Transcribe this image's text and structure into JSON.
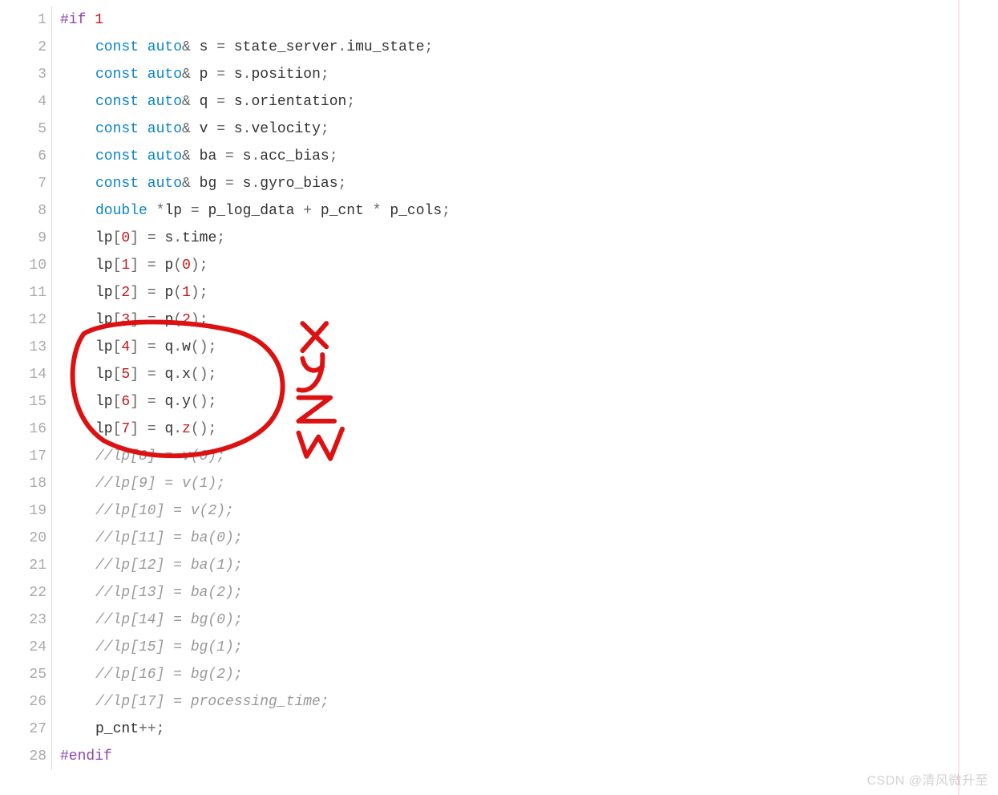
{
  "watermark": "CSDN @清风微升至",
  "code": {
    "indent": [
      0,
      1,
      1,
      1,
      1,
      1,
      1,
      1,
      1,
      1,
      1,
      1,
      1,
      1,
      1,
      1,
      1,
      1,
      1,
      1,
      1,
      1,
      1,
      1,
      1,
      1,
      1,
      0
    ],
    "lines": [
      [
        {
          "c": "tok-pre",
          "t": "#if "
        },
        {
          "c": "tok-num",
          "t": "1"
        }
      ],
      [
        {
          "c": "tok-kw",
          "t": "const auto"
        },
        {
          "c": "tok-amp",
          "t": "& "
        },
        {
          "c": "tok-id",
          "t": "s "
        },
        {
          "c": "tok-op",
          "t": "= "
        },
        {
          "c": "tok-id",
          "t": "state_server"
        },
        {
          "c": "tok-punc",
          "t": "."
        },
        {
          "c": "tok-id",
          "t": "imu_state"
        },
        {
          "c": "tok-punc",
          "t": ";"
        }
      ],
      [
        {
          "c": "tok-kw",
          "t": "const auto"
        },
        {
          "c": "tok-amp",
          "t": "& "
        },
        {
          "c": "tok-id",
          "t": "p "
        },
        {
          "c": "tok-op",
          "t": "= "
        },
        {
          "c": "tok-id",
          "t": "s"
        },
        {
          "c": "tok-punc",
          "t": "."
        },
        {
          "c": "tok-id",
          "t": "position"
        },
        {
          "c": "tok-punc",
          "t": ";"
        }
      ],
      [
        {
          "c": "tok-kw",
          "t": "const auto"
        },
        {
          "c": "tok-amp",
          "t": "& "
        },
        {
          "c": "tok-id",
          "t": "q "
        },
        {
          "c": "tok-op",
          "t": "= "
        },
        {
          "c": "tok-id",
          "t": "s"
        },
        {
          "c": "tok-punc",
          "t": "."
        },
        {
          "c": "tok-id",
          "t": "orientation"
        },
        {
          "c": "tok-punc",
          "t": ";"
        }
      ],
      [
        {
          "c": "tok-kw",
          "t": "const auto"
        },
        {
          "c": "tok-amp",
          "t": "& "
        },
        {
          "c": "tok-id",
          "t": "v "
        },
        {
          "c": "tok-op",
          "t": "= "
        },
        {
          "c": "tok-id",
          "t": "s"
        },
        {
          "c": "tok-punc",
          "t": "."
        },
        {
          "c": "tok-id",
          "t": "velocity"
        },
        {
          "c": "tok-punc",
          "t": ";"
        }
      ],
      [
        {
          "c": "tok-kw",
          "t": "const auto"
        },
        {
          "c": "tok-amp",
          "t": "& "
        },
        {
          "c": "tok-id",
          "t": "ba "
        },
        {
          "c": "tok-op",
          "t": "= "
        },
        {
          "c": "tok-id",
          "t": "s"
        },
        {
          "c": "tok-punc",
          "t": "."
        },
        {
          "c": "tok-id",
          "t": "acc_bias"
        },
        {
          "c": "tok-punc",
          "t": ";"
        }
      ],
      [
        {
          "c": "tok-kw",
          "t": "const auto"
        },
        {
          "c": "tok-amp",
          "t": "& "
        },
        {
          "c": "tok-id",
          "t": "bg "
        },
        {
          "c": "tok-op",
          "t": "= "
        },
        {
          "c": "tok-id",
          "t": "s"
        },
        {
          "c": "tok-punc",
          "t": "."
        },
        {
          "c": "tok-id",
          "t": "gyro_bias"
        },
        {
          "c": "tok-punc",
          "t": ";"
        }
      ],
      [
        {
          "c": "tok-kw",
          "t": "double "
        },
        {
          "c": "tok-op",
          "t": "*"
        },
        {
          "c": "tok-id",
          "t": "lp "
        },
        {
          "c": "tok-op",
          "t": "= "
        },
        {
          "c": "tok-id",
          "t": "p_log_data "
        },
        {
          "c": "tok-op",
          "t": "+ "
        },
        {
          "c": "tok-id",
          "t": "p_cnt "
        },
        {
          "c": "tok-op",
          "t": "* "
        },
        {
          "c": "tok-id",
          "t": "p_cols"
        },
        {
          "c": "tok-punc",
          "t": ";"
        }
      ],
      [
        {
          "c": "tok-id",
          "t": "lp"
        },
        {
          "c": "tok-punc",
          "t": "["
        },
        {
          "c": "tok-num",
          "t": "0"
        },
        {
          "c": "tok-punc",
          "t": "] "
        },
        {
          "c": "tok-op",
          "t": "= "
        },
        {
          "c": "tok-id",
          "t": "s"
        },
        {
          "c": "tok-punc",
          "t": "."
        },
        {
          "c": "tok-mem",
          "t": "time"
        },
        {
          "c": "tok-punc",
          "t": ";"
        }
      ],
      [
        {
          "c": "tok-id",
          "t": "lp"
        },
        {
          "c": "tok-punc",
          "t": "["
        },
        {
          "c": "tok-num",
          "t": "1"
        },
        {
          "c": "tok-punc",
          "t": "] "
        },
        {
          "c": "tok-op",
          "t": "= "
        },
        {
          "c": "tok-id",
          "t": "p"
        },
        {
          "c": "tok-punc",
          "t": "("
        },
        {
          "c": "tok-num",
          "t": "0"
        },
        {
          "c": "tok-punc",
          "t": ");"
        }
      ],
      [
        {
          "c": "tok-id",
          "t": "lp"
        },
        {
          "c": "tok-punc",
          "t": "["
        },
        {
          "c": "tok-num",
          "t": "2"
        },
        {
          "c": "tok-punc",
          "t": "] "
        },
        {
          "c": "tok-op",
          "t": "= "
        },
        {
          "c": "tok-id",
          "t": "p"
        },
        {
          "c": "tok-punc",
          "t": "("
        },
        {
          "c": "tok-num",
          "t": "1"
        },
        {
          "c": "tok-punc",
          "t": ");"
        }
      ],
      [
        {
          "c": "tok-id",
          "t": "lp"
        },
        {
          "c": "tok-punc",
          "t": "["
        },
        {
          "c": "tok-num",
          "t": "3"
        },
        {
          "c": "tok-punc",
          "t": "] "
        },
        {
          "c": "tok-op",
          "t": "= "
        },
        {
          "c": "tok-id",
          "t": "p"
        },
        {
          "c": "tok-punc",
          "t": "("
        },
        {
          "c": "tok-num",
          "t": "2"
        },
        {
          "c": "tok-punc",
          "t": ");"
        }
      ],
      [
        {
          "c": "tok-id",
          "t": "lp"
        },
        {
          "c": "tok-punc",
          "t": "["
        },
        {
          "c": "tok-num",
          "t": "4"
        },
        {
          "c": "tok-punc",
          "t": "] "
        },
        {
          "c": "tok-op",
          "t": "= "
        },
        {
          "c": "tok-id",
          "t": "q"
        },
        {
          "c": "tok-punc",
          "t": "."
        },
        {
          "c": "tok-mem",
          "t": "w"
        },
        {
          "c": "tok-punc",
          "t": "();"
        }
      ],
      [
        {
          "c": "tok-id",
          "t": "lp"
        },
        {
          "c": "tok-punc",
          "t": "["
        },
        {
          "c": "tok-num",
          "t": "5"
        },
        {
          "c": "tok-punc",
          "t": "] "
        },
        {
          "c": "tok-op",
          "t": "= "
        },
        {
          "c": "tok-id",
          "t": "q"
        },
        {
          "c": "tok-punc",
          "t": "."
        },
        {
          "c": "tok-mem",
          "t": "x"
        },
        {
          "c": "tok-punc",
          "t": "();"
        }
      ],
      [
        {
          "c": "tok-id",
          "t": "lp"
        },
        {
          "c": "tok-punc",
          "t": "["
        },
        {
          "c": "tok-num",
          "t": "6"
        },
        {
          "c": "tok-punc",
          "t": "] "
        },
        {
          "c": "tok-op",
          "t": "= "
        },
        {
          "c": "tok-id",
          "t": "q"
        },
        {
          "c": "tok-punc",
          "t": "."
        },
        {
          "c": "tok-mem",
          "t": "y"
        },
        {
          "c": "tok-punc",
          "t": "();"
        }
      ],
      [
        {
          "c": "tok-id",
          "t": "lp"
        },
        {
          "c": "tok-punc",
          "t": "["
        },
        {
          "c": "tok-num",
          "t": "7"
        },
        {
          "c": "tok-punc",
          "t": "] "
        },
        {
          "c": "tok-op",
          "t": "= "
        },
        {
          "c": "tok-id",
          "t": "q"
        },
        {
          "c": "tok-punc",
          "t": "."
        },
        {
          "c": "tok-memr",
          "t": "z"
        },
        {
          "c": "tok-punc",
          "t": "();"
        }
      ],
      [
        {
          "c": "tok-cmt",
          "t": "//lp[8] = v(0);"
        }
      ],
      [
        {
          "c": "tok-cmt",
          "t": "//lp[9] = v(1);"
        }
      ],
      [
        {
          "c": "tok-cmt",
          "t": "//lp[10] = v(2);"
        }
      ],
      [
        {
          "c": "tok-cmt",
          "t": "//lp[11] = ba(0);"
        }
      ],
      [
        {
          "c": "tok-cmt",
          "t": "//lp[12] = ba(1);"
        }
      ],
      [
        {
          "c": "tok-cmt",
          "t": "//lp[13] = ba(2);"
        }
      ],
      [
        {
          "c": "tok-cmt",
          "t": "//lp[14] = bg(0);"
        }
      ],
      [
        {
          "c": "tok-cmt",
          "t": "//lp[15] = bg(1);"
        }
      ],
      [
        {
          "c": "tok-cmt",
          "t": "//lp[16] = bg(2);"
        }
      ],
      [
        {
          "c": "tok-cmt",
          "t": "//lp[17] = processing_time;"
        }
      ],
      [
        {
          "c": "tok-id",
          "t": "p_cnt"
        },
        {
          "c": "tok-op",
          "t": "++"
        },
        {
          "c": "tok-punc",
          "t": ";"
        }
      ],
      [
        {
          "c": "tok-pre",
          "t": "#endif"
        }
      ]
    ]
  },
  "annotation_labels": [
    "x",
    "y",
    "z",
    "w"
  ]
}
